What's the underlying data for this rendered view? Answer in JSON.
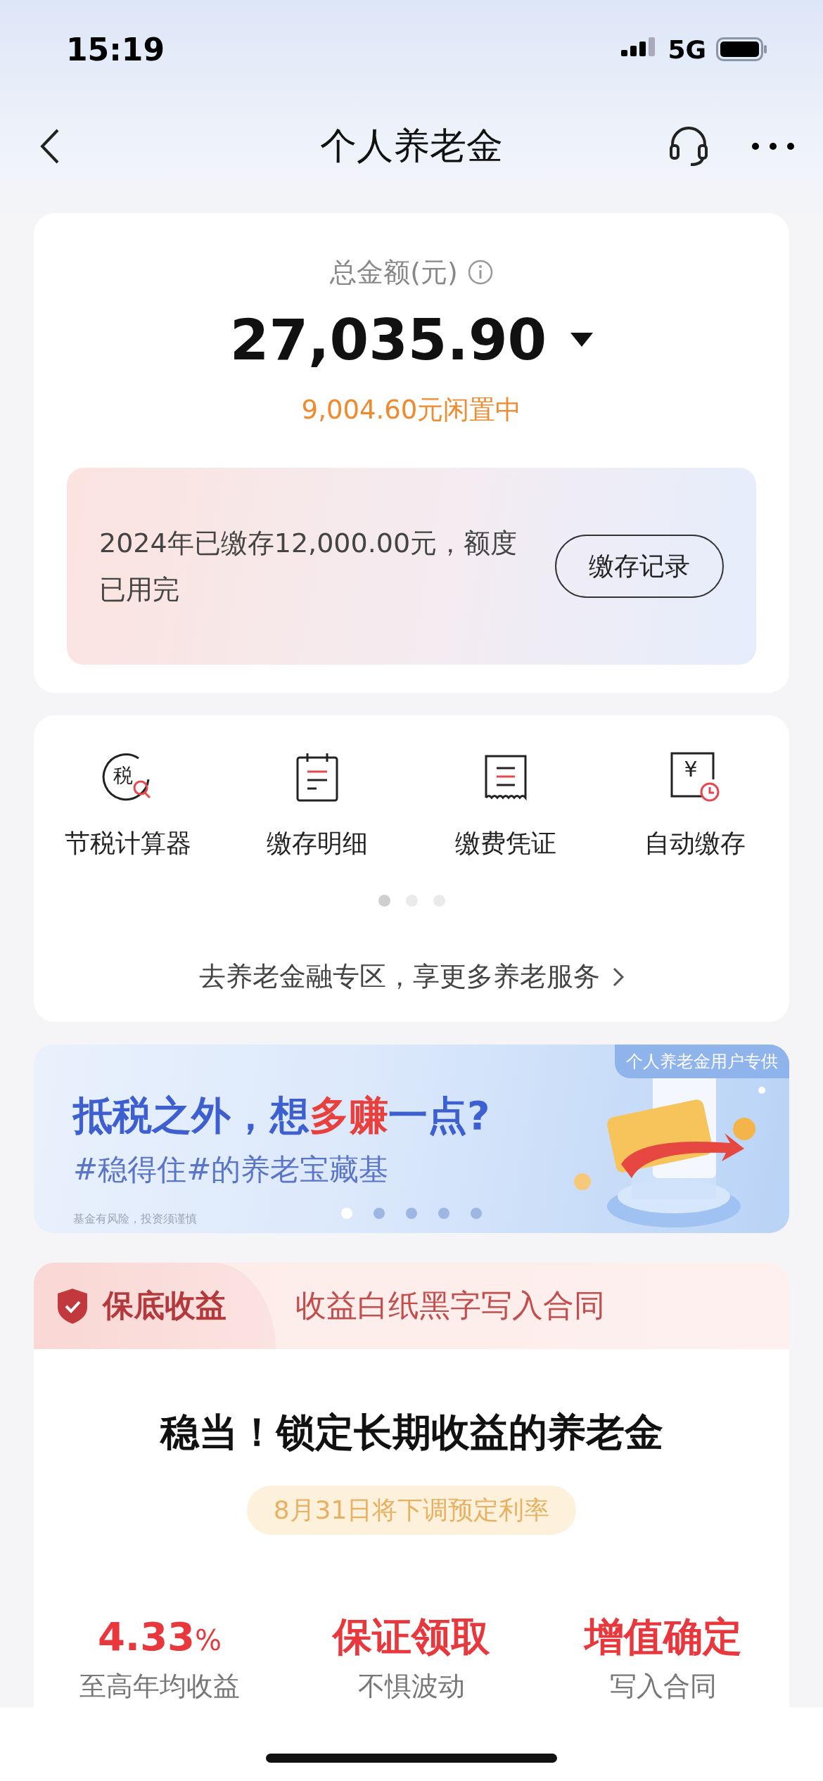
{
  "status_bar": {
    "time": "15:19",
    "network": "5G"
  },
  "nav": {
    "title": "个人养老金"
  },
  "balance": {
    "label": "总金额(元)",
    "amount": "27,035.90",
    "idle": "9,004.60元闲置中",
    "notice": "2024年已缴存12,000.00元，额度已用完",
    "button": "缴存记录"
  },
  "services": {
    "items": [
      {
        "kind": "tax",
        "icon_text": "税",
        "label": "节税计算器"
      },
      {
        "kind": "calendar",
        "label": "缴存明细"
      },
      {
        "kind": "receipt",
        "label": "缴费凭证"
      },
      {
        "kind": "yen",
        "icon_text": "¥",
        "label": "自动缴存"
      }
    ],
    "pages": [
      {
        "selected": true
      },
      {
        "selected": false
      },
      {
        "selected": false
      }
    ],
    "link": "去养老金融专区，享更多养老服务"
  },
  "banner": {
    "tag": "个人养老金用户专供",
    "title": [
      {
        "text": "抵税之外，想",
        "highlight": false
      },
      {
        "text": "多赚",
        "highlight": true
      },
      {
        "text": "一点?",
        "highlight": false
      }
    ],
    "subtitle": "#稳得住#的养老宝藏基",
    "disclaimer": "基金有风险，投资须谨慎",
    "pages": [
      {
        "selected": true
      },
      {
        "selected": false
      },
      {
        "selected": false
      },
      {
        "selected": false
      },
      {
        "selected": false
      }
    ]
  },
  "product": {
    "badge": "保底收益",
    "slogan": "收益白纸黑字写入合同",
    "title": "稳当！锁定长期收益的养老金",
    "notice": "8月31日将下调预定利率",
    "stats": [
      {
        "value": "4.33",
        "unit": "%",
        "label": "至高年均收益"
      },
      {
        "value": "保证领取",
        "label": "不惧波动"
      },
      {
        "value": "增值确定",
        "label": "写入合同"
      }
    ]
  }
}
